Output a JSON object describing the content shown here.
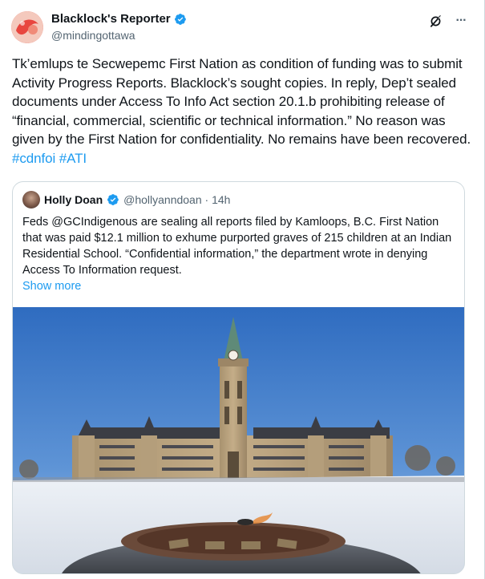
{
  "author": {
    "display_name": "Blacklock's Reporter",
    "handle": "@mindingottawa",
    "verified_icon": "verified-badge-icon"
  },
  "header_icons": [
    "grok-icon",
    "more-icon"
  ],
  "header_more_label": "···",
  "tweet": {
    "text": "Tk’emlups te Secwepemc First Nation as condition of funding was to submit Activity Progress Reports. Blacklock’s sought copies. In reply, Dep’t sealed documents under Access To Info Act section 20.1.b prohibiting release of “financial, commercial, scientific or technical information.” No reason was given by the First Nation for confidentiality. No remains have been recovered. ",
    "hashtags": [
      "#cdnfoi",
      "#ATI"
    ]
  },
  "quote": {
    "display_name": "Holly Doan",
    "handle_time": "@hollyanndoan · 14h",
    "text": "Feds @GCIndigenous are sealing all reports filed by Kamloops, B.C. First Nation that was paid $12.1 million to exhume purported graves of 215 children at an Indian Residential School. “Confidential information,” the department wrote in denying Access To Information request.",
    "show_more": "Show more",
    "image_subject": "parliament-centre-block-winter-photo"
  },
  "colors": {
    "link": "#1d9bf0",
    "verified": "#1d9bf0",
    "secondary_text": "#536471",
    "border": "#cfd9de"
  }
}
